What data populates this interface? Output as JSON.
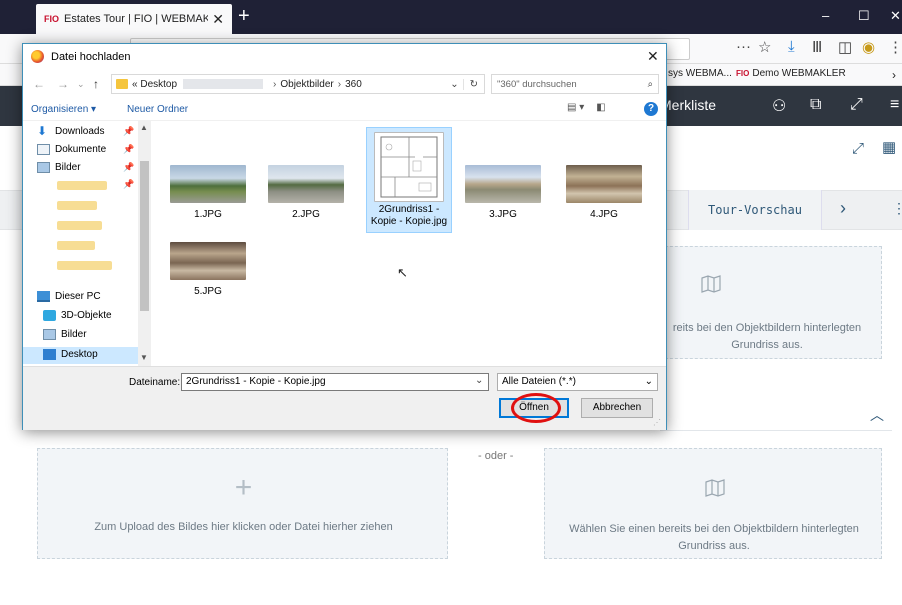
{
  "browser": {
    "tab_title": "Estates Tour | FIO | WEBMAKLER",
    "tab_brand": "FIO",
    "new_tab": "+",
    "win_minimize": "–",
    "win_maximize": "☐",
    "win_close": "✕",
    "bookmarks": [
      {
        "label": "sys WEBMA...",
        "brand": ""
      },
      {
        "label": "Demo WEBMAKLER",
        "brand": "FIO"
      }
    ],
    "bookmark_more": "›"
  },
  "page": {
    "header_label": "Merkliste",
    "tour_tab": "Tour-Vorschau",
    "tab_next": "›",
    "tab_more": "⋮",
    "or_label": "- oder -",
    "upload_plus": "+",
    "upload_text": "Zum Upload des Bildes hier klicken oder Datei hierher ziehen",
    "top_box_text": "reits bei den Objektbildern hinterlegten Grundriss aus.",
    "choose_text": "Wählen Sie einen bereits bei den Objektbildern hinterlegten Grundriss aus."
  },
  "dialog": {
    "title": "Datei hochladen",
    "close": "✕",
    "breadcrumb": [
      "«",
      "Desktop",
      "›",
      "Objektbilder",
      "›",
      "360"
    ],
    "search_placeholder": "\"360\" durchsuchen",
    "organize": "Organisieren ▾",
    "new_folder": "Neuer Ordner",
    "help": "?",
    "nav_items": [
      {
        "label": "Downloads",
        "icon": "download-icon",
        "pinned": true
      },
      {
        "label": "Dokumente",
        "icon": "documents-icon",
        "pinned": true
      },
      {
        "label": "Bilder",
        "icon": "pictures-icon",
        "pinned": true
      },
      {
        "label": "Dieser PC",
        "icon": "computer-icon",
        "pinned": false
      },
      {
        "label": "3D-Objekte",
        "icon": "3d-objects-icon",
        "pinned": false
      },
      {
        "label": "Bilder",
        "icon": "pictures-icon",
        "pinned": false
      },
      {
        "label": "Desktop",
        "icon": "desktop-icon",
        "pinned": false
      }
    ],
    "files": [
      {
        "name": "1.JPG"
      },
      {
        "name": "2.JPG"
      },
      {
        "name": "2Grundriss1 - Kopie - Kopie.jpg"
      },
      {
        "name": "3.JPG"
      },
      {
        "name": "4.JPG"
      },
      {
        "name": "5.JPG"
      }
    ],
    "filename_label": "Dateiname:",
    "filename_value": "2Grundriss1 - Kopie - Kopie.jpg",
    "filter_value": "Alle Dateien (*.*)",
    "open_button": "Öffnen",
    "cancel_button": "Abbrechen"
  },
  "colors": {
    "tabbar": "#1f2136",
    "page_header": "#2f3640",
    "accent_blue": "#0078d7",
    "selection": "#cce8ff",
    "highlight_circle": "#e01010"
  }
}
